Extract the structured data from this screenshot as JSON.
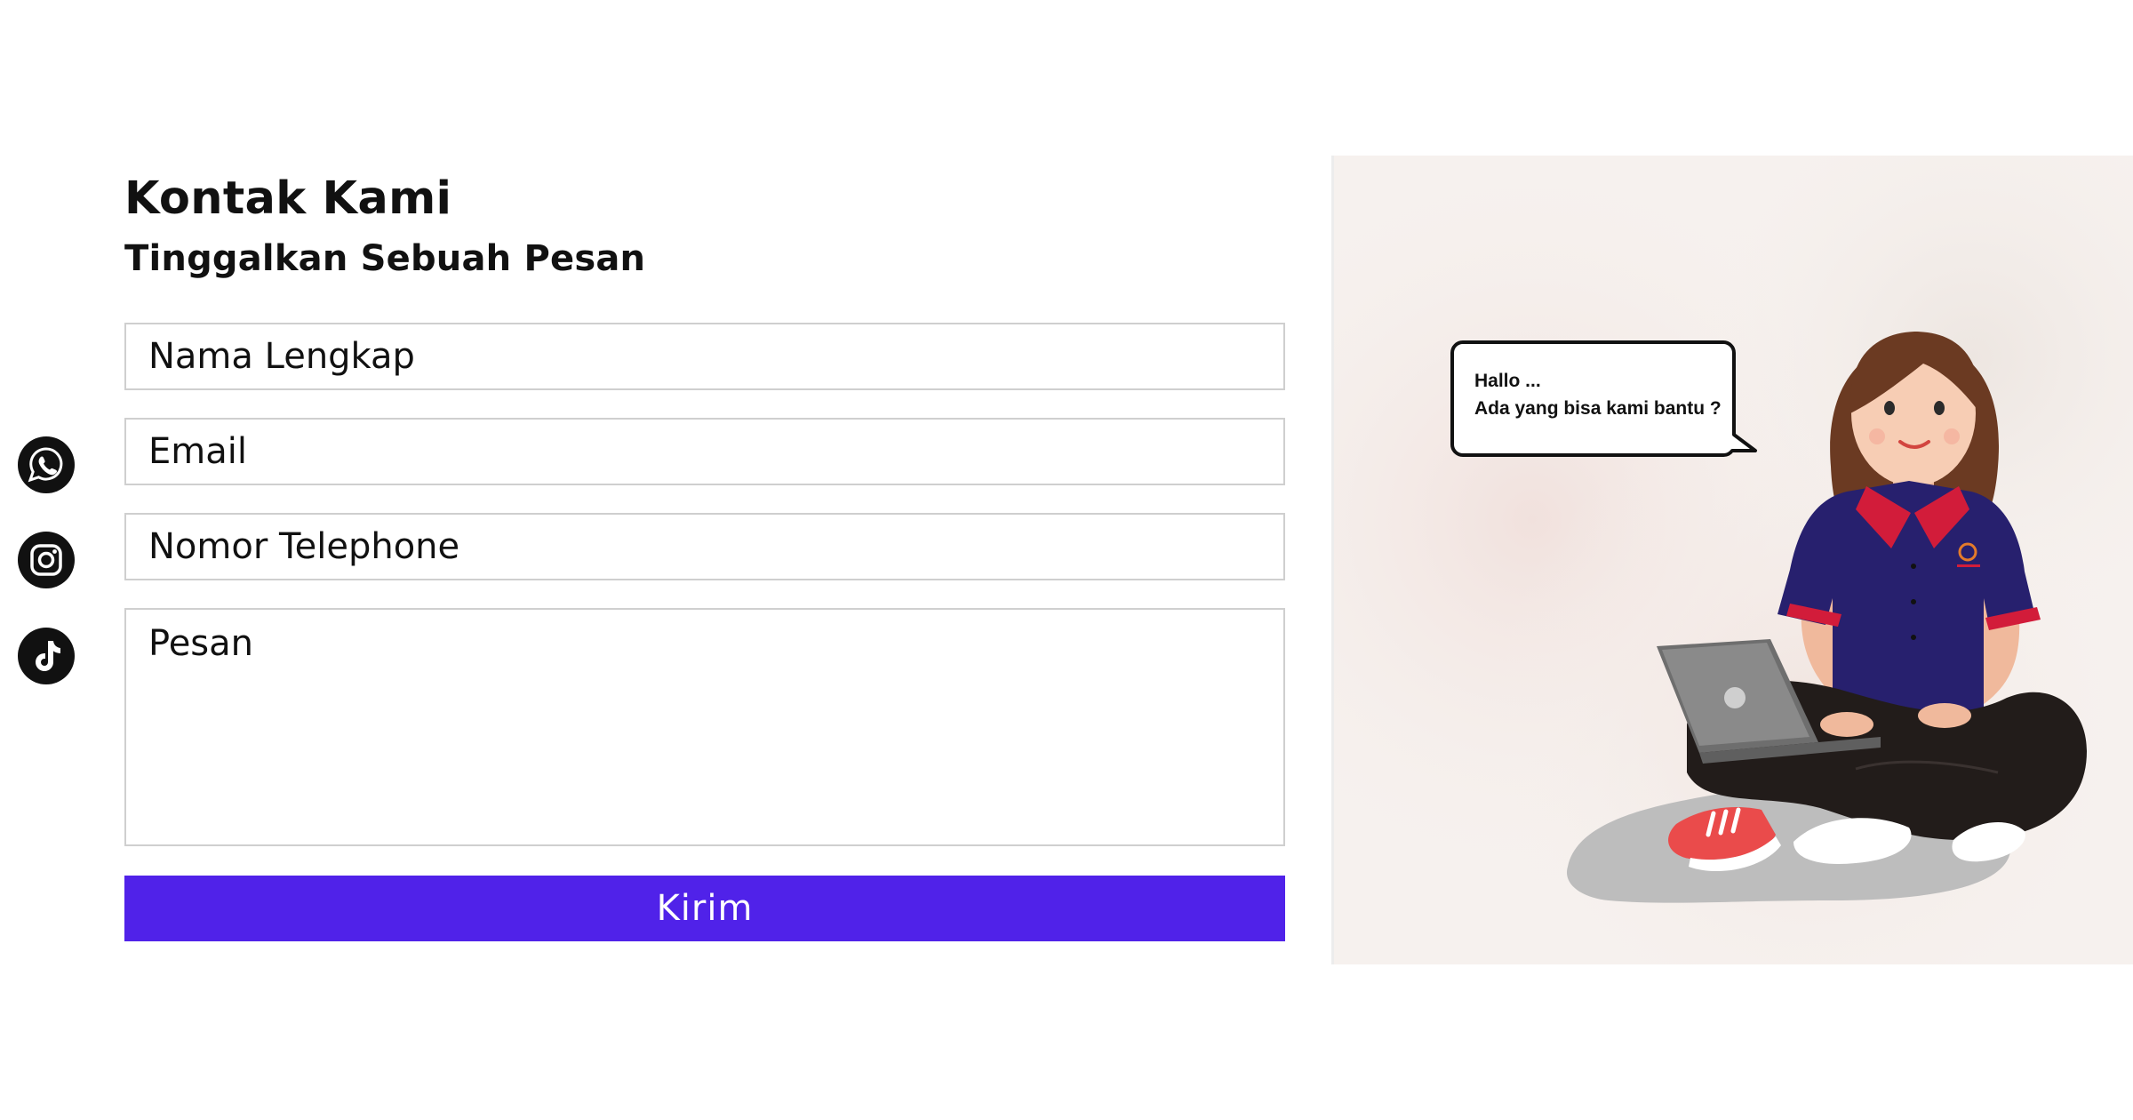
{
  "contact": {
    "title": "Kontak Kami",
    "subtitle": "Tinggalkan Sebuah Pesan"
  },
  "form": {
    "name_placeholder": "Nama Lengkap",
    "email_placeholder": "Email",
    "phone_placeholder": "Nomor Telephone",
    "message_placeholder": "Pesan",
    "submit_label": "Kirim"
  },
  "social": [
    {
      "icon": "whatsapp-icon"
    },
    {
      "icon": "instagram-icon"
    },
    {
      "icon": "tiktok-icon"
    }
  ],
  "illustration": {
    "bubble_line1": "Hallo ...",
    "bubble_line2": "Ada yang bisa kami bantu ?"
  },
  "colors": {
    "accent": "#5022e9",
    "shirt": "#27206e",
    "collar": "#d21c3a"
  }
}
